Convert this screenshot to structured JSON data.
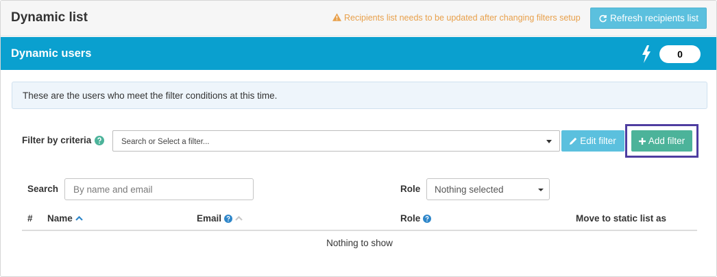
{
  "header": {
    "title": "Dynamic list",
    "warning_text": "Recipients list needs to be updated after changing filters setup",
    "refresh_label": "Refresh recipients list"
  },
  "band": {
    "title": "Dynamic users",
    "count": "0"
  },
  "info": {
    "text": "These are the users who meet the filter conditions at this time."
  },
  "filter": {
    "label": "Filter by criteria",
    "placeholder": "Search or Select a filter...",
    "edit_label": "Edit filter",
    "add_label": "Add filter"
  },
  "search": {
    "label": "Search",
    "placeholder": "By name and email",
    "value": ""
  },
  "role": {
    "label": "Role",
    "selected": "Nothing selected"
  },
  "table": {
    "columns": {
      "index": "#",
      "name": "Name",
      "email": "Email",
      "role": "Role",
      "move": "Move to static list as"
    },
    "empty_text": "Nothing to show"
  },
  "colors": {
    "accent_blue": "#0aa0cf",
    "button_info": "#5bc0de",
    "button_success": "#4cb39a",
    "warning": "#e8a04b",
    "highlight_border": "#4e3da0"
  },
  "icons": {
    "warning": "warning-triangle-icon",
    "refresh": "refresh-icon",
    "bolt": "bolt-icon",
    "help": "question-circle-icon",
    "edit": "pencil-icon",
    "add": "plus-icon",
    "sort_asc": "chevron-up-icon"
  }
}
